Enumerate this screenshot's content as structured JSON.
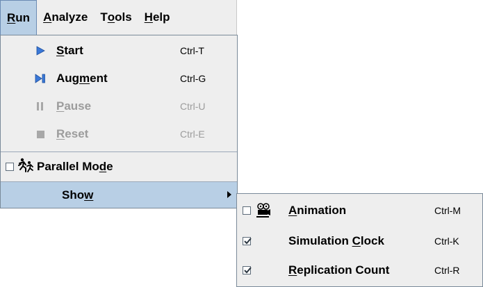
{
  "menubar": {
    "items": [
      {
        "text": "Run",
        "underline": "R",
        "rest": "un"
      },
      {
        "text": "Analyze",
        "underline": "A",
        "rest": "nalyze"
      },
      {
        "text": "Tools",
        "pre": "T",
        "underline": "o",
        "rest": "ols"
      },
      {
        "text": "Help",
        "underline": "H",
        "rest": "elp"
      }
    ]
  },
  "run_menu": {
    "start": {
      "pre": "",
      "u": "S",
      "post": "tart",
      "accel": "Ctrl-T"
    },
    "augment": {
      "pre": "Aug",
      "u": "m",
      "post": "ent",
      "accel": "Ctrl-G"
    },
    "pause": {
      "pre": "",
      "u": "P",
      "post": "ause",
      "accel": "Ctrl-U"
    },
    "reset": {
      "pre": "",
      "u": "R",
      "post": "eset",
      "accel": "Ctrl-E"
    },
    "parallel": {
      "pre": "Parallel Mo",
      "u": "d",
      "post": "e"
    },
    "show": {
      "pre": "Sho",
      "u": "w",
      "post": ""
    }
  },
  "show_menu": {
    "animation": {
      "pre": "",
      "u": "A",
      "post": "nimation",
      "accel": "Ctrl-M",
      "checked": false
    },
    "clock": {
      "pre": "Simulation ",
      "u": "C",
      "post": "lock",
      "accel": "Ctrl-K",
      "checked": true
    },
    "replication": {
      "pre": "",
      "u": "R",
      "post": "eplication Count",
      "accel": "Ctrl-R",
      "checked": true
    }
  },
  "colors": {
    "highlight": "#b8cfe5",
    "icon_blue": "#3a78d8",
    "disabled": "#9c9c9c"
  }
}
